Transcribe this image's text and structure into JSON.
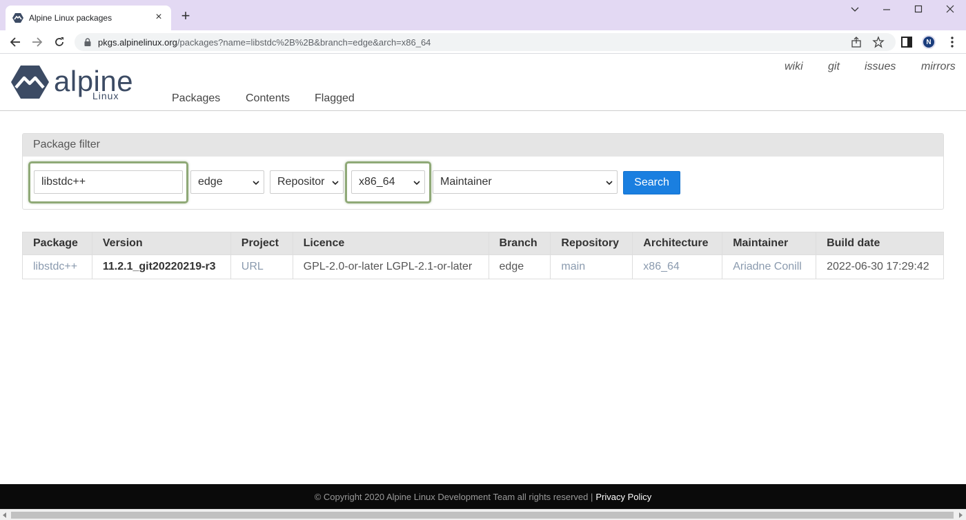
{
  "browser": {
    "tab_title": "Alpine Linux packages",
    "url_host": "pkgs.alpinelinux.org",
    "url_path": "/packages?name=libstdc%2B%2B&branch=edge&arch=x86_64",
    "avatar_letter": "N"
  },
  "header": {
    "logo_word": "alpine",
    "logo_sub": "Linux",
    "main_nav": [
      "Packages",
      "Contents",
      "Flagged"
    ],
    "top_nav": [
      "wiki",
      "git",
      "issues",
      "mirrors"
    ]
  },
  "filter": {
    "title": "Package filter",
    "name_value": "libstdc++",
    "branch_value": "edge",
    "repository_value": "Repositor",
    "arch_value": "x86_64",
    "maintainer_value": "Maintainer",
    "search_label": "Search"
  },
  "table": {
    "headers": [
      "Package",
      "Version",
      "Project",
      "Licence",
      "Branch",
      "Repository",
      "Architecture",
      "Maintainer",
      "Build date"
    ],
    "rows": [
      {
        "package": "libstdc++",
        "version": "11.2.1_git20220219-r3",
        "project": "URL",
        "licence": "GPL-2.0-or-later LGPL-2.1-or-later",
        "branch": "edge",
        "repository": "main",
        "architecture": "x86_64",
        "maintainer": "Ariadne Conill",
        "build_date": "2022-06-30 17:29:42"
      }
    ]
  },
  "footer": {
    "copyright": "© Copyright 2020 Alpine Linux Development Team all rights reserved |",
    "privacy": "Privacy Policy"
  },
  "colors": {
    "tabbar": "#e3d9f3",
    "accent_button": "#1a7fe0",
    "highlight_border": "#8fa977",
    "logo": "#3c4b64"
  }
}
